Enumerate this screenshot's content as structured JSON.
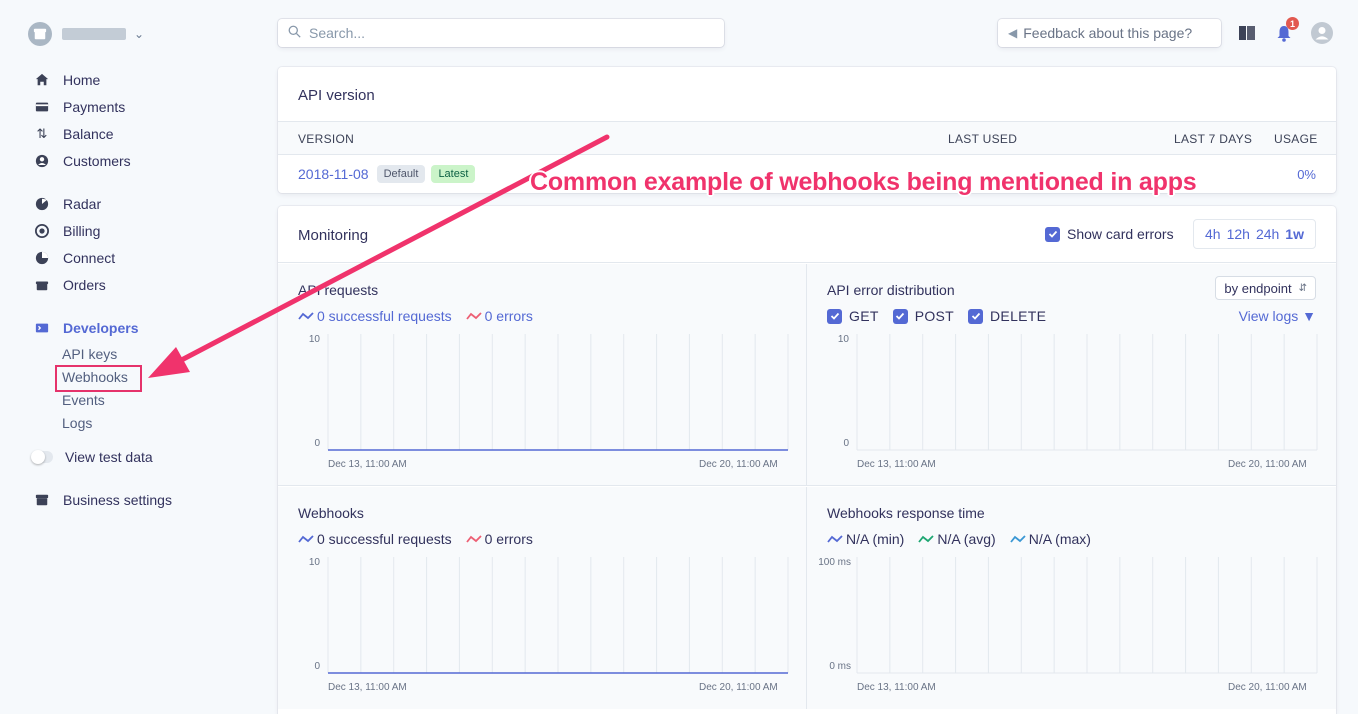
{
  "sidebar": {
    "nav": [
      {
        "label": "Home",
        "icon": "home-icon"
      },
      {
        "label": "Payments",
        "icon": "payments-icon"
      },
      {
        "label": "Balance",
        "icon": "balance-icon"
      },
      {
        "label": "Customers",
        "icon": "customers-icon"
      },
      {
        "label": "Radar",
        "icon": "radar-icon"
      },
      {
        "label": "Billing",
        "icon": "billing-icon"
      },
      {
        "label": "Connect",
        "icon": "connect-icon"
      },
      {
        "label": "Orders",
        "icon": "orders-icon"
      }
    ],
    "developers": {
      "label": "Developers",
      "items": [
        "API keys",
        "Webhooks",
        "Events",
        "Logs"
      ]
    },
    "test_data": "View test data",
    "business_settings": "Business settings"
  },
  "topbar": {
    "search_placeholder": "Search...",
    "feedback": "Feedback about this page?",
    "notification_count": "1"
  },
  "api_version": {
    "title": "API version",
    "columns": [
      "VERSION",
      "LAST USED",
      "LAST 7 DAYS",
      "USAGE"
    ],
    "version": "2018-11-08",
    "tags": [
      "Default",
      "Latest"
    ],
    "usage": "0%"
  },
  "monitoring": {
    "title": "Monitoring",
    "show_card_errors": "Show card errors",
    "ranges": [
      "4h",
      "12h",
      "24h",
      "1w"
    ],
    "selected_range": "1w",
    "panels": {
      "api_requests": {
        "title": "API requests",
        "legend": [
          "0 successful requests",
          "0 errors"
        ],
        "y_max": "10",
        "y_min": "0",
        "x_start": "Dec 13, 11:00 AM",
        "x_end": "Dec 20, 11:00 AM"
      },
      "api_errors": {
        "title": "API error distribution",
        "dropdown": "by endpoint",
        "methods": [
          "GET",
          "POST",
          "DELETE"
        ],
        "view_logs": "View logs",
        "y_max": "10",
        "y_min": "0",
        "x_start": "Dec 13, 11:00 AM",
        "x_end": "Dec 20, 11:00 AM"
      },
      "webhooks": {
        "title": "Webhooks",
        "legend": [
          "0 successful requests",
          "0 errors"
        ],
        "y_max": "10",
        "y_min": "0",
        "x_start": "Dec 13, 11:00 AM",
        "x_end": "Dec 20, 11:00 AM"
      },
      "webhooks_response": {
        "title": "Webhooks response time",
        "legend": [
          "N/A (min)",
          "N/A (avg)",
          "N/A (max)"
        ],
        "y_max": "100 ms",
        "y_min": "0 ms",
        "x_start": "Dec 13, 11:00 AM",
        "x_end": "Dec 20, 11:00 AM"
      }
    }
  },
  "annotation": "Common example of webhooks being mentioned in apps",
  "colors": {
    "accent": "#5469d4",
    "error": "#ed5f74",
    "success": "#1ea672",
    "annotation": "#f0336c"
  }
}
